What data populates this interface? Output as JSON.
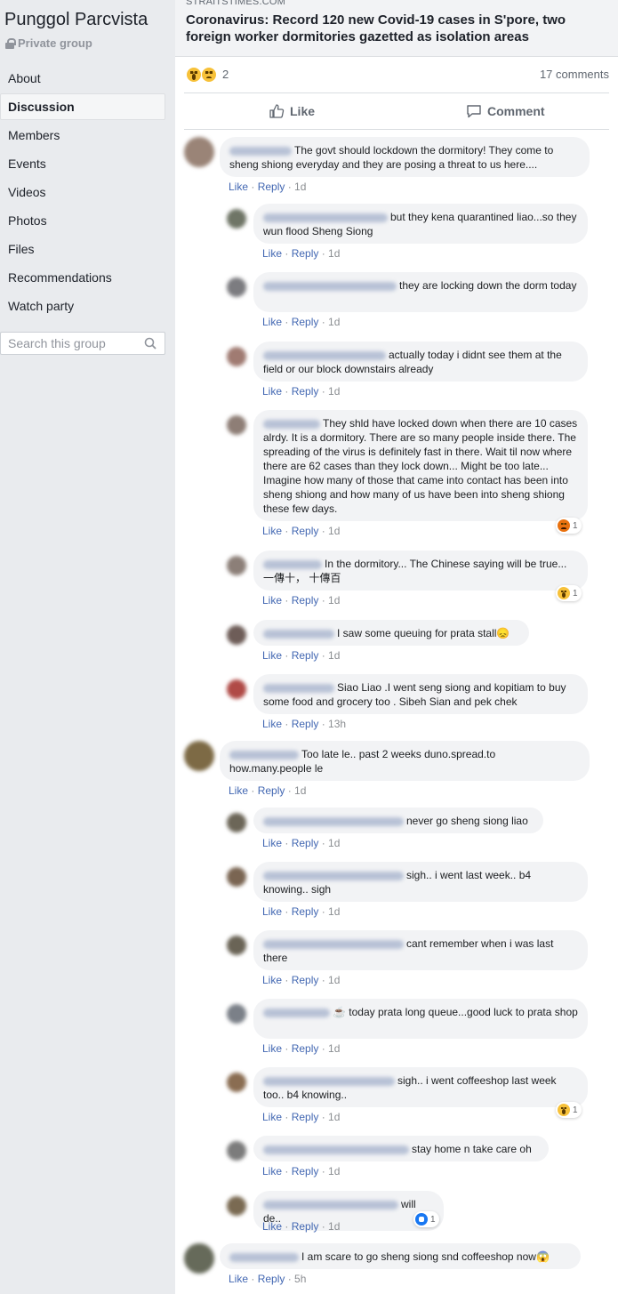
{
  "sidebar": {
    "group_name": "Punggol Parcvista",
    "group_type": "Private group",
    "nav": [
      "About",
      "Discussion",
      "Members",
      "Events",
      "Videos",
      "Photos",
      "Files",
      "Recommendations",
      "Watch party"
    ],
    "active": "Discussion",
    "search_placeholder": "Search this group"
  },
  "post": {
    "source": "STRAITSTIMES.COM",
    "headline": "Coronavirus: Record 120 new Covid-19 cases in S'pore, two foreign worker dormitories gazetted as isolation areas",
    "reaction_count": "2",
    "reactions": [
      "wow",
      "sad"
    ],
    "comments_count": "17 comments",
    "like_label": "Like",
    "comment_label": "Comment"
  },
  "meta_labels": {
    "like": "Like",
    "reply": "Reply"
  },
  "comments": [
    {
      "level": 0,
      "text": "The govt should lockdown the dormitory! They come to sheng shiong everyday and they are posing a threat to us here....",
      "time": "1d"
    },
    {
      "level": 1,
      "text": "but they kena quarantined liao...so they wun flood Sheng Siong",
      "time": "1d"
    },
    {
      "level": 1,
      "text": "they are locking down the dorm today",
      "time": "1d"
    },
    {
      "level": 1,
      "text": "actually today i didnt see them at the field or our block downstairs already",
      "time": "1d"
    },
    {
      "level": 1,
      "text": "They shld have locked down when there are 10 cases alrdy. It is a dormitory. There are so many people inside there. The spreading of the virus is definitely fast in there. Wait til now where there are 62 cases than they lock down... Might be too late... Imagine how many of those that came into contact has been into sheng shiong and how many of us have been into sheng shiong these few days.",
      "time": "1d",
      "reaction": "angry",
      "reaction_count": "1"
    },
    {
      "level": 1,
      "text": "In the dormitory... The Chinese saying will be true... 一傳十， 十傳百",
      "time": "1d",
      "reaction": "wow",
      "reaction_count": "1"
    },
    {
      "level": 1,
      "text": "I saw some queuing for prata stall😞",
      "time": "1d"
    },
    {
      "level": 1,
      "text": "Siao Liao .I went seng siong and kopitiam to buy some food and grocery too . Sibeh Sian and pek chek",
      "time": "13h"
    },
    {
      "level": 0,
      "text": "Too late le.. past 2 weeks duno.spread.to how.many.people le",
      "time": "1d"
    },
    {
      "level": 1,
      "text": "never go sheng siong liao",
      "time": "1d"
    },
    {
      "level": 1,
      "text": "sigh.. i went last week.. b4 knowing.. sigh",
      "time": "1d"
    },
    {
      "level": 1,
      "text": "cant remember when i was last there",
      "time": "1d"
    },
    {
      "level": 1,
      "text": "☕ today prata long queue...good luck to prata shop",
      "time": "1d"
    },
    {
      "level": 1,
      "text": "sigh.. i went coffeeshop last week too.. b4 knowing..",
      "time": "1d",
      "reaction": "wow",
      "reaction_count": "1"
    },
    {
      "level": 1,
      "text": "stay home n take care oh",
      "time": "1d"
    },
    {
      "level": 1,
      "text": "will de..",
      "time": "1d",
      "reaction": "like",
      "reaction_count": "1"
    },
    {
      "level": 0,
      "text": "I am scare to go sheng siong snd coffeeshop now😱",
      "time": "5h"
    }
  ]
}
